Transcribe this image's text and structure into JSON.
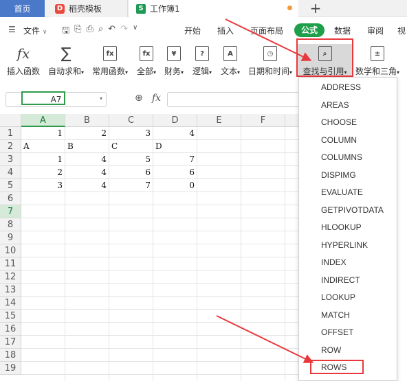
{
  "tabs": {
    "home": "首页",
    "template": "稻壳模板",
    "workbook": "工作簿1",
    "new_tab": "+"
  },
  "menu": {
    "file": "文件",
    "start": "开始",
    "insert": "插入",
    "layout": "页面布局",
    "formula": "公式",
    "data": "数据",
    "review": "审阅",
    "view": "视"
  },
  "ribbon": {
    "insert_func": "插入函数",
    "autosum": "自动求和",
    "common_func": "常用函数",
    "all": "全部",
    "finance": "财务",
    "logic": "逻辑",
    "text": "文本",
    "datetime": "日期和时间",
    "lookup": "查找与引用",
    "math": "数学和三角"
  },
  "formula_bar": {
    "namebox": "A7",
    "fx": "fx"
  },
  "grid": {
    "columns": [
      "A",
      "B",
      "C",
      "D",
      "E",
      "F"
    ],
    "rows": [
      "1",
      "2",
      "3",
      "4",
      "5",
      "6",
      "7",
      "8",
      "9",
      "10",
      "11",
      "12",
      "13",
      "14",
      "15",
      "16",
      "17",
      "18",
      "19"
    ],
    "cells": [
      [
        "1",
        "2",
        "3",
        "4"
      ],
      [
        "A",
        "B",
        "C",
        "D"
      ],
      [
        "1",
        "4",
        "5",
        "7"
      ],
      [
        "2",
        "4",
        "6",
        "6"
      ],
      [
        "3",
        "4",
        "7",
        "0"
      ]
    ],
    "active_cell": "A7"
  },
  "dropdown": {
    "items": [
      "ADDRESS",
      "AREAS",
      "CHOOSE",
      "COLUMN",
      "COLUMNS",
      "DISPIMG",
      "EVALUATE",
      "GETPIVOTDATA",
      "HLOOKUP",
      "HYPERLINK",
      "INDEX",
      "INDIRECT",
      "LOOKUP",
      "MATCH",
      "OFFSET",
      "ROW",
      "ROWS"
    ],
    "highlighted": "ROWS"
  },
  "colors": {
    "accent_green": "#1e9f4a",
    "highlight_red": "#e8383d",
    "home_tab": "#4a79c9"
  }
}
